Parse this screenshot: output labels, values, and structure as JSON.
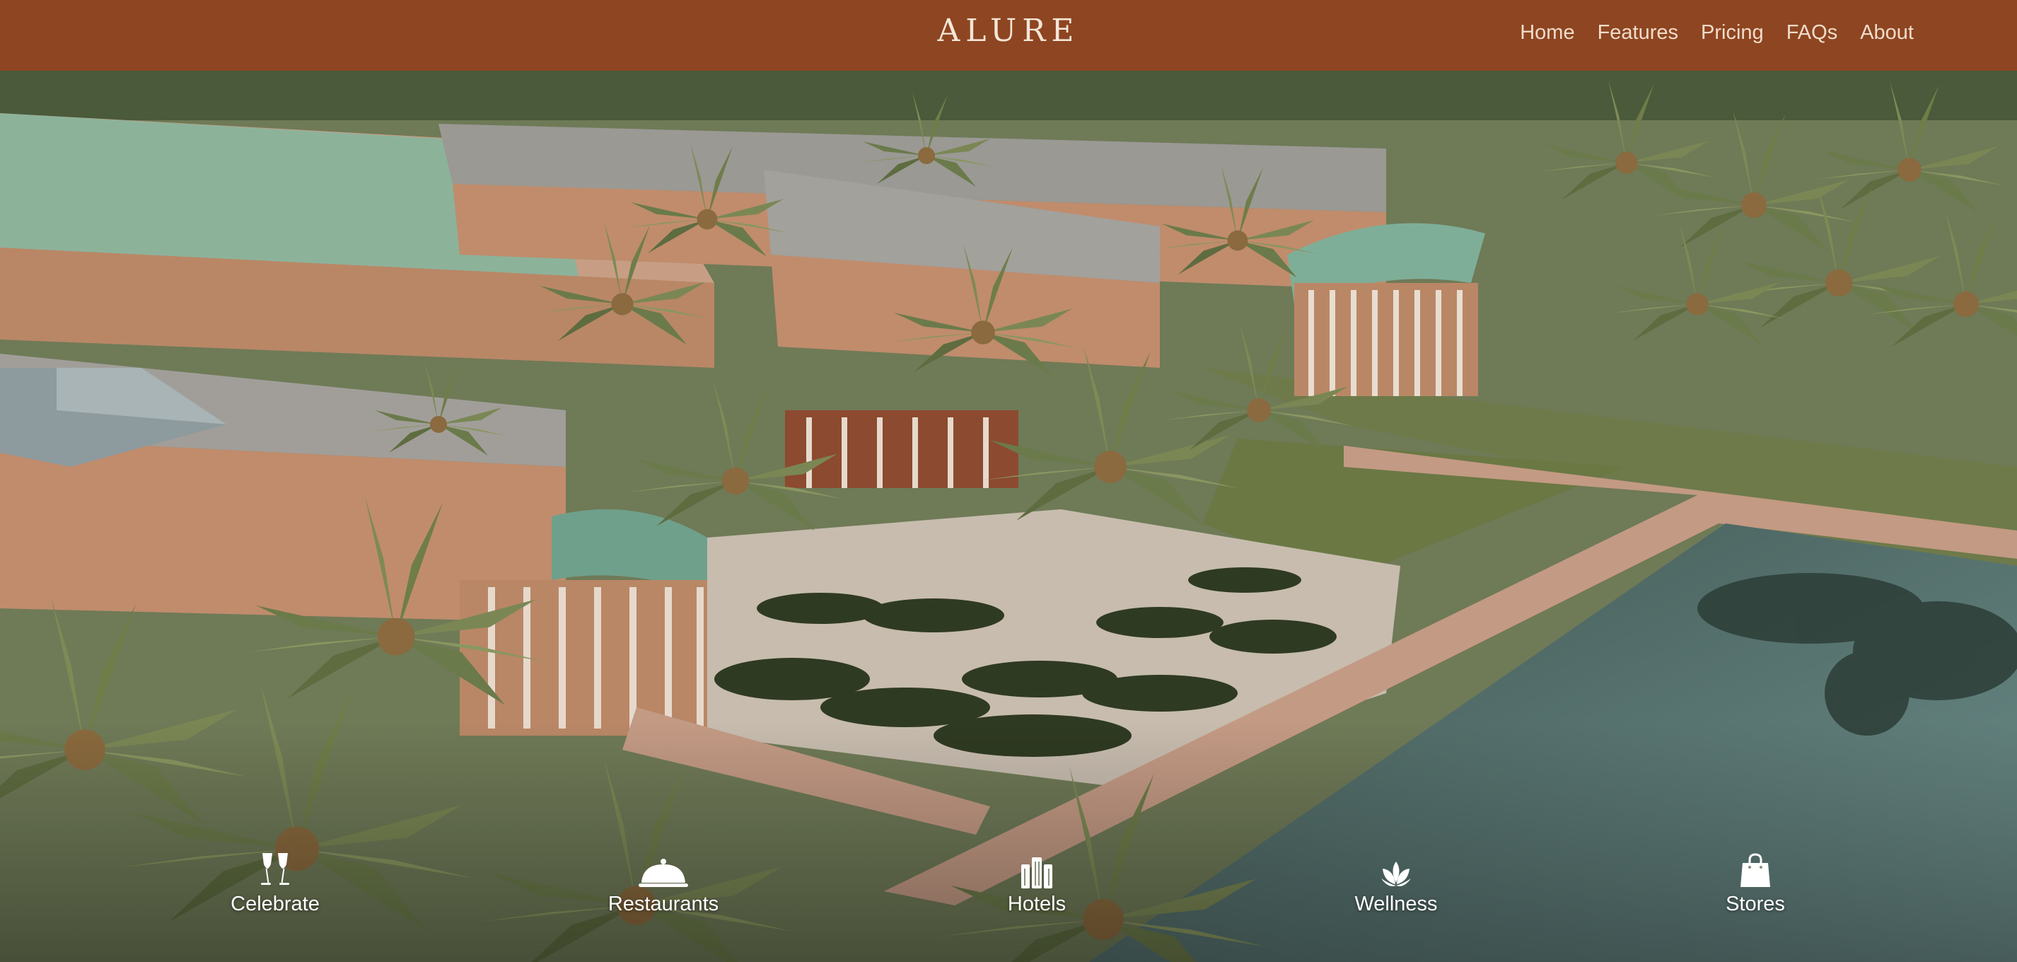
{
  "header": {
    "brand": "ALURE",
    "nav": [
      {
        "label": "Home",
        "icon": ""
      },
      {
        "label": "Features"
      },
      {
        "label": "Pricing"
      },
      {
        "label": "FAQs"
      },
      {
        "label": "About"
      }
    ]
  },
  "categories": [
    {
      "label": "Celebrate",
      "icon": "champagne-glasses-icon"
    },
    {
      "label": "Restaurants",
      "icon": "cloche-icon"
    },
    {
      "label": "Hotels",
      "icon": "hotel-building-icon"
    },
    {
      "label": "Wellness",
      "icon": "lotus-icon"
    },
    {
      "label": "Stores",
      "icon": "shopping-bag-icon"
    }
  ],
  "colors": {
    "header_bg": "#8e4521",
    "brand_text": "#f3e6d8",
    "nav_text": "#f0dccb",
    "category_text": "#ffffff"
  }
}
